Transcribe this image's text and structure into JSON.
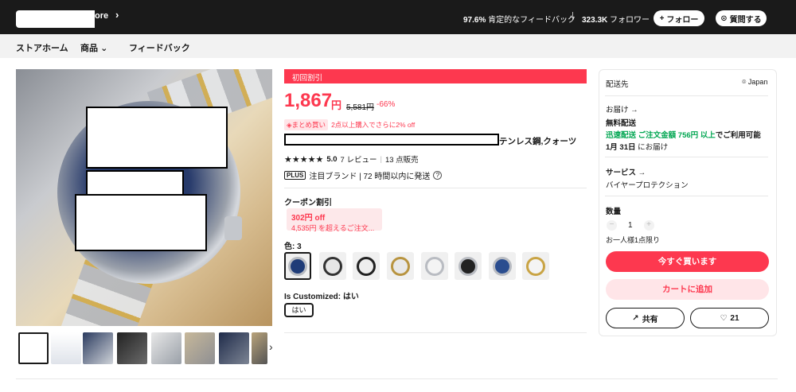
{
  "header": {
    "store_name_visible": "ore",
    "feedback_pct": "97.6%",
    "feedback_label": "肯定的なフィードバック",
    "separator": "|",
    "followers_count": "323.3K",
    "followers_label": "フォロワー",
    "follow_label": "フォロー",
    "ask_label": "質問する"
  },
  "nav": {
    "items": [
      "ストアホーム",
      "商品",
      "フィードバック"
    ]
  },
  "product": {
    "badge": "初回割引",
    "price": "1,867",
    "price_unit": "円",
    "original_price": "5,581円",
    "discount": "-66%",
    "bundle_tag": "まとめ買い",
    "bundle_text": "2点以上購入でさらに2% off",
    "title_tail": "テンレス鋼,クォーツ",
    "stars": "★★★★★",
    "rating": "5.0",
    "reviews": "7 レビュー",
    "dot": "|",
    "sold": "13 点販売",
    "plus_tag": "PLUS",
    "plus_text": "注目ブランド | 72 時間以内に発送",
    "coupon_label": "クーポン割引",
    "coupon_amount": "302円 off",
    "coupon_condition": "4,535円 を超えるご注文...",
    "color_label": "色: 3",
    "custom_label": "Is Customized: はい",
    "custom_option": "はい"
  },
  "panel": {
    "ship_to": "配送先",
    "country": "Japan",
    "delivery": "お届け →",
    "free_ship": "無料配送",
    "fast_ship": "迅速配送 ご注文金額 756円 以上",
    "fast_ship_tail": "でご利用可能",
    "delivery_date": "1月 31日",
    "delivery_date_tail": "にお届け",
    "service": "サービス →",
    "buyer_protection": "バイヤープロテクション",
    "qty_label": "数量",
    "qty_value": "1",
    "qty_limit": "お一人様1点限り",
    "buy_now": "今すぐ買います",
    "add_cart": "カートに追加",
    "share": "共有",
    "wish_count": "21"
  },
  "colors": {
    "accent": "#fd384f",
    "green": "#00a651",
    "header_bg": "#1a1a1a"
  }
}
